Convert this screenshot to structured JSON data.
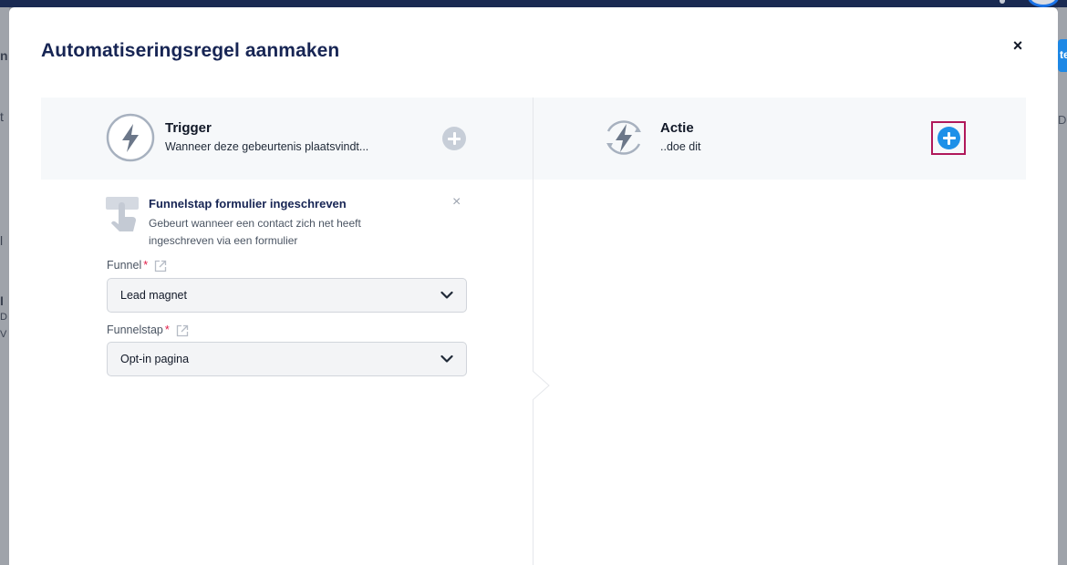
{
  "background": {
    "left_glyphs": [
      "n",
      "t",
      "l",
      "I",
      "D",
      "V"
    ],
    "right_button_label": "te",
    "right_text": "De"
  },
  "modal": {
    "title": "Automatiseringsregel aanmaken",
    "close_label": "×"
  },
  "trigger_panel": {
    "title": "Trigger",
    "subtitle": "Wanneer deze gebeurtenis plaatsvindt..."
  },
  "action_panel": {
    "title": "Actie",
    "subtitle": "..doe dit"
  },
  "selected_trigger": {
    "name": "Funnelstap formulier ingeschreven",
    "description": "Gebeurt wanneer een contact zich net heeft ingeschreven via een formulier",
    "remove_label": "×"
  },
  "fields": {
    "funnel": {
      "label": "Funnel",
      "required_mark": "*",
      "value": "Lead magnet"
    },
    "funnelstap": {
      "label": "Funnelstap",
      "required_mark": "*",
      "value": "Opt-in pagina"
    }
  },
  "colors": {
    "title": "#172554",
    "accent_blue": "#1e90e8",
    "highlight_border": "#b0185a",
    "panel_bg": "#f6f8fa",
    "required": "#e11d48"
  }
}
